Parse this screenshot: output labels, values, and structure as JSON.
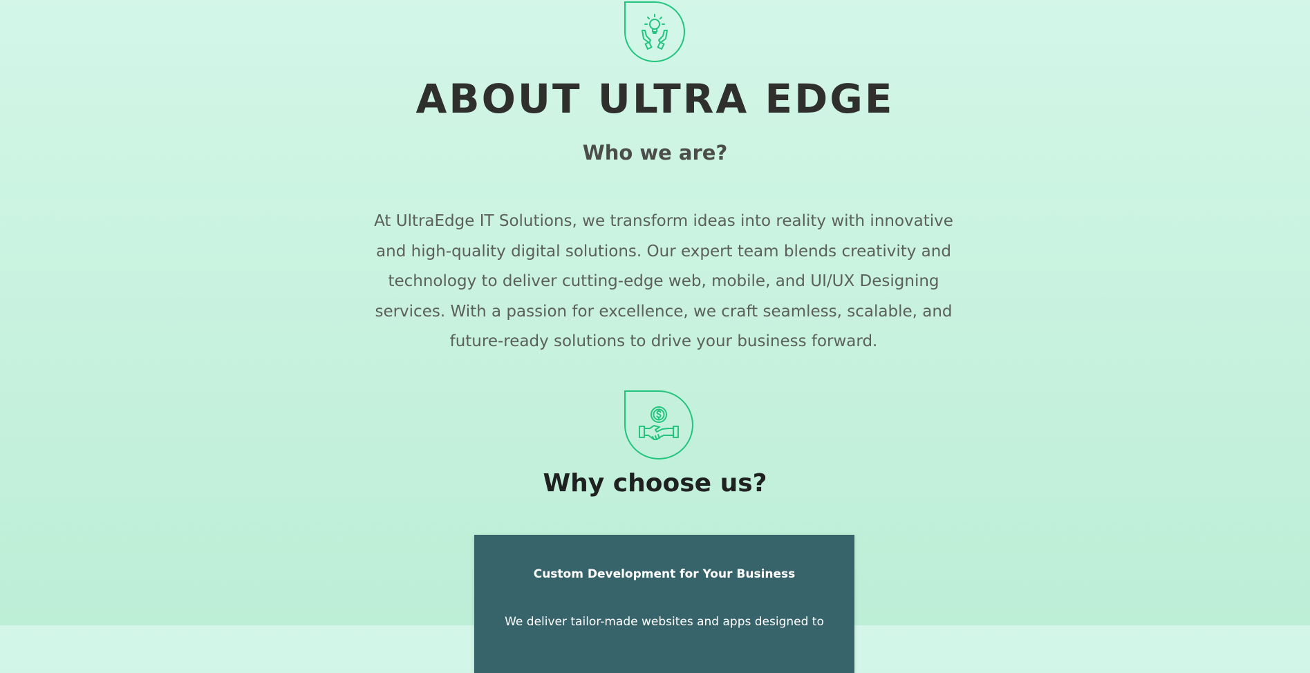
{
  "about": {
    "icon": "hands-lightbulb-icon",
    "title": "ABOUT ULTRA EDGE",
    "subtitle": "Who we are?",
    "body": "At UltraEdge IT Solutions, we transform ideas into reality with innovative and high-quality digital solutions. Our expert team blends creativity and technology to deliver cutting-edge web, mobile, and UI/UX Designing services. With a passion for excellence, we craft seamless, scalable, and future-ready solutions to drive your business forward."
  },
  "why": {
    "icon": "handshake-coin-icon",
    "title": "Why choose us?",
    "cards": [
      {
        "title": "Custom Development for Your Business",
        "body": "We deliver tailor-made websites and apps designed to"
      }
    ]
  },
  "colors": {
    "accent": "#22c47e",
    "card_background": "#37636b",
    "heading": "#2f302e"
  }
}
